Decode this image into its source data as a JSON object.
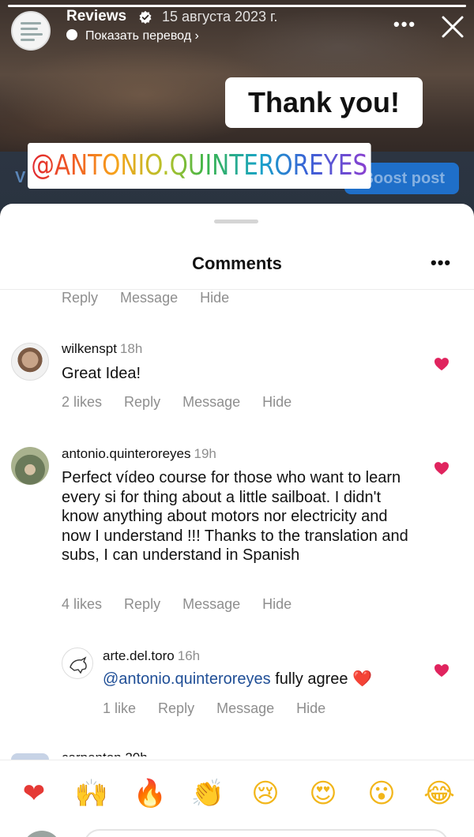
{
  "story": {
    "account_name": "Reviews",
    "date": "15 августа 2023 г.",
    "translate_label": "Показать перевод",
    "translate_chevron": "›",
    "more_label": "•••",
    "close_label": "close",
    "sticker_text": "Thank you!",
    "mention_sticker": "@ANTONIO.QUINTEROREYES",
    "partial_left_text": "V",
    "boost_button": "Boost post",
    "progress": 1.0
  },
  "comments_sheet": {
    "title": "Comments",
    "more_label": "•••",
    "top_actions": [
      "Reply",
      "Message",
      "Hide"
    ],
    "comments": [
      {
        "username": "wilkenspt",
        "time": "18h",
        "text": "Great Idea!",
        "likes": "2 likes",
        "actions": [
          "Reply",
          "Message",
          "Hide"
        ],
        "liked": true
      },
      {
        "username": "antonio.quinteroreyes",
        "time": "19h",
        "text": "Perfect vídeo course for those who want to learn every si for thing about a little sailboat. I didn't know anything about motors nor electricity and now I understand !!! Thanks to the translation and subs, I can understand in Spanish",
        "likes": "4 likes",
        "actions": [
          "Reply",
          "Message",
          "Hide"
        ],
        "liked": true
      },
      {
        "username": "arte.del.toro",
        "time": "16h",
        "mention": "@antonio.quinteroreyes",
        "text": " fully agree ",
        "emoji": "❤️",
        "likes": "1 like",
        "actions": [
          "Reply",
          "Message",
          "Hide"
        ],
        "liked": true,
        "is_reply": true
      }
    ],
    "next_peek": "carpenton 20h"
  },
  "emoji_bar": {
    "emojis": [
      {
        "name": "red-heart-icon",
        "glyph": "❤"
      },
      {
        "name": "raising-hands-icon",
        "glyph": "🙌"
      },
      {
        "name": "fire-icon",
        "glyph": "🔥"
      },
      {
        "name": "clapping-hands-icon",
        "glyph": "👏"
      },
      {
        "name": "crying-face-icon",
        "glyph": "😢"
      },
      {
        "name": "heart-eyes-icon",
        "glyph": "😍"
      },
      {
        "name": "surprised-face-icon",
        "glyph": "😮"
      },
      {
        "name": "tears-of-joy-icon",
        "glyph": "😂"
      }
    ]
  },
  "colors": {
    "like_heart": "#e0245e",
    "mention_link": "#1f4e96",
    "muted_text": "#8e8e8e",
    "boost_blue": "#1f6fc9"
  }
}
